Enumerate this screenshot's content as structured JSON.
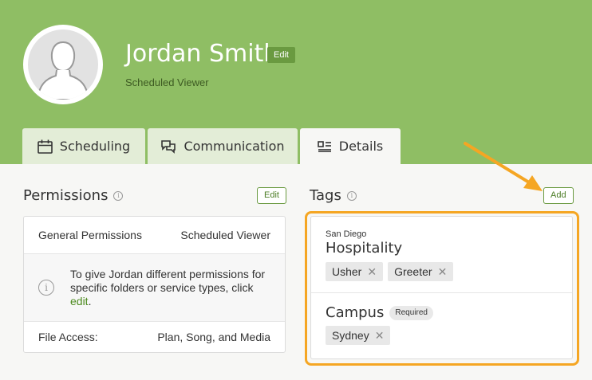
{
  "profile": {
    "name": "Jordan Smith",
    "edit_label": "Edit",
    "role": "Scheduled Viewer"
  },
  "tabs": [
    {
      "label": "Scheduling",
      "icon": "calendar-icon"
    },
    {
      "label": "Communication",
      "icon": "chat-bubbles-icon"
    },
    {
      "label": "Details",
      "icon": "details-card-icon"
    }
  ],
  "permissions": {
    "title": "Permissions",
    "edit_label": "Edit",
    "general_label": "General Permissions",
    "general_value": "Scheduled Viewer",
    "note": "To give Jordan different permissions for specific folders or service types, click",
    "note_link": "edit",
    "note_end": ".",
    "file_access_label": "File Access:",
    "file_access_value": "Plan, Song, and Media"
  },
  "tags": {
    "title": "Tags",
    "add_label": "Add",
    "groups": [
      {
        "subtitle": "San Diego",
        "title": "Hospitality",
        "chips": [
          "Usher",
          "Greeter"
        ]
      },
      {
        "title": "Campus",
        "badge": "Required",
        "chips": [
          "Sydney"
        ]
      }
    ]
  },
  "colors": {
    "header_green": "#8fbe64",
    "accent_green": "#6a9a40",
    "highlight_orange": "#f5a623"
  }
}
